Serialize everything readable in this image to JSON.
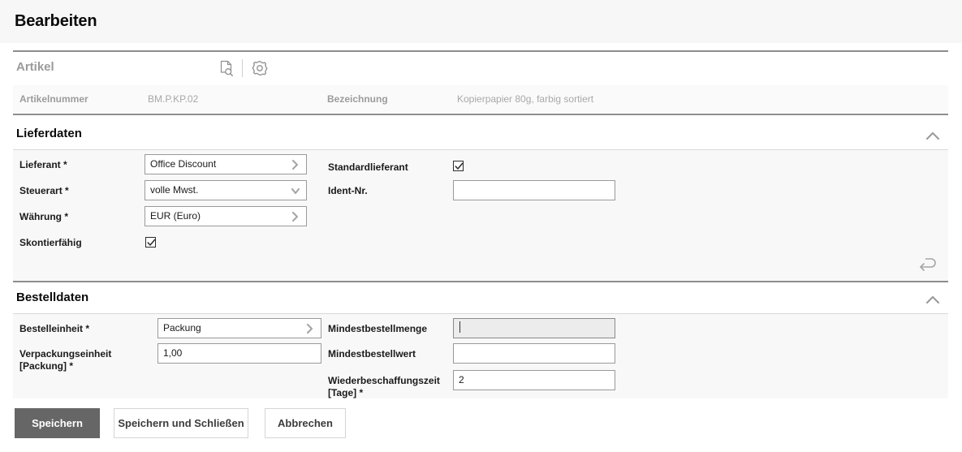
{
  "header": {
    "title": "Bearbeiten"
  },
  "article_section": {
    "title": "Artikel",
    "icons": [
      {
        "name": "document-search-icon",
        "label": "Artikelvorschau"
      },
      {
        "name": "gear-icon",
        "label": "Einstellungen"
      }
    ],
    "fields": [
      {
        "label": "Artikelnummer",
        "value": "BM.P.KP.02"
      },
      {
        "label": "Bezeichnung",
        "value": "Kopierpapier 80g, farbig sortiert"
      }
    ]
  },
  "lieferdaten": {
    "title": "Lieferdaten",
    "collapse_icon": "chevron-up-icon",
    "reset_icon": "undo-arrow-icon",
    "fields": {
      "lieferant": {
        "label": "Lieferant",
        "required": "*",
        "value": "Office Discount",
        "control": "value-help"
      },
      "steuerart": {
        "label": "Steuerart",
        "required": "*",
        "value": "volle Mwst.",
        "control": "dropdown"
      },
      "waehrung": {
        "label": "Währung",
        "required": "*",
        "value": "EUR (Euro)",
        "control": "value-help"
      },
      "skontierfaehig": {
        "label": "Skontierfähig",
        "checked": true,
        "control": "checkbox"
      },
      "standardlieferant": {
        "label": "Standardlieferant",
        "checked": true,
        "control": "checkbox"
      },
      "ident_nr": {
        "label": "Ident-Nr.",
        "value": "",
        "control": "text"
      }
    }
  },
  "bestelldaten": {
    "title": "Bestelldaten",
    "collapse_icon": "chevron-up-icon",
    "fields": {
      "bestelleinheit": {
        "label": "Bestelleinheit",
        "required": "*",
        "value": "Packung",
        "control": "value-help"
      },
      "verpackungseinheit": {
        "label": "Verpackungseinheit [Packung]",
        "label_line1": "Verpackungseinheit",
        "label_line2": "[Packung] *",
        "required": "*",
        "value": "1,00",
        "control": "text"
      },
      "mindestbestellmenge": {
        "label": "Mindestbestellmenge",
        "value": "",
        "control": "text",
        "focused": true
      },
      "mindestbestellwert": {
        "label": "Mindestbestellwert",
        "value": "",
        "control": "text"
      },
      "wiederbeschaffungszeit": {
        "label": "Wiederbeschaffungszeit [Tage]",
        "label_line1": "Wiederbeschaffungszeit",
        "label_line2": "[Tage] *",
        "required": "*",
        "value": "2",
        "control": "text"
      }
    }
  },
  "footer": {
    "buttons": [
      {
        "name": "save-button",
        "label": "Speichern",
        "style": "primary"
      },
      {
        "name": "save-and-close-button",
        "label": "Speichern und Schließen",
        "style": "secondary"
      },
      {
        "name": "cancel-button",
        "label": "Abbrechen",
        "style": "secondary"
      }
    ]
  },
  "colors": {
    "primary_button": "#666666",
    "rule": "#8d8d8d",
    "panel_bg": "#f8f8f8",
    "titlebar_bg": "#f7f7f7",
    "muted_text": "#9a9a9a"
  }
}
